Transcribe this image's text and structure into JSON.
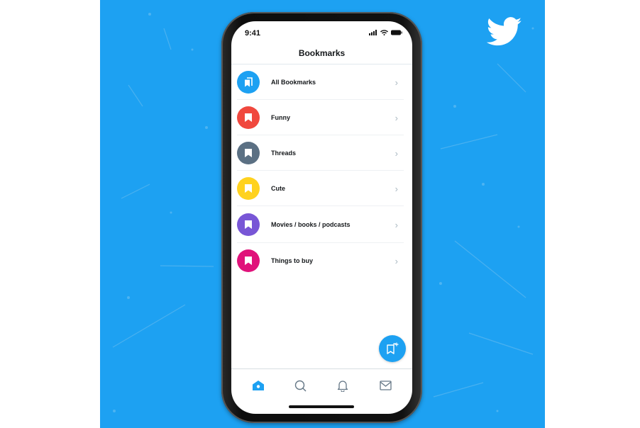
{
  "colors": {
    "brand": "#1da1f2",
    "text": "#14171a",
    "chevron": "#aab8c2"
  },
  "status_bar": {
    "time": "9:41",
    "icons": [
      "signal-icon",
      "wifi-icon",
      "battery-icon"
    ]
  },
  "header": {
    "title": "Bookmarks"
  },
  "bookmark_lists": [
    {
      "label": "All Bookmarks",
      "color": "#1da1f2",
      "icon": "bookmarks-stack-icon"
    },
    {
      "label": "Funny",
      "color": "#f0483e",
      "icon": "bookmark-icon"
    },
    {
      "label": "Threads",
      "color": "#5b7083",
      "icon": "bookmark-icon"
    },
    {
      "label": "Cute",
      "color": "#ffd21f",
      "icon": "bookmark-icon"
    },
    {
      "label": "Movies / books / podcasts",
      "color": "#7856d6",
      "icon": "bookmark-icon"
    },
    {
      "label": "Things to buy",
      "color": "#e0127a",
      "icon": "bookmark-icon"
    }
  ],
  "fab": {
    "icon": "add-bookmark-folder-icon"
  },
  "tab_bar": {
    "tabs": [
      {
        "name": "home",
        "icon": "home-icon",
        "active": true
      },
      {
        "name": "search",
        "icon": "search-icon",
        "active": false
      },
      {
        "name": "notifications",
        "icon": "bell-icon",
        "active": false
      },
      {
        "name": "messages",
        "icon": "mail-icon",
        "active": false
      }
    ]
  },
  "chevron_glyph": "›"
}
